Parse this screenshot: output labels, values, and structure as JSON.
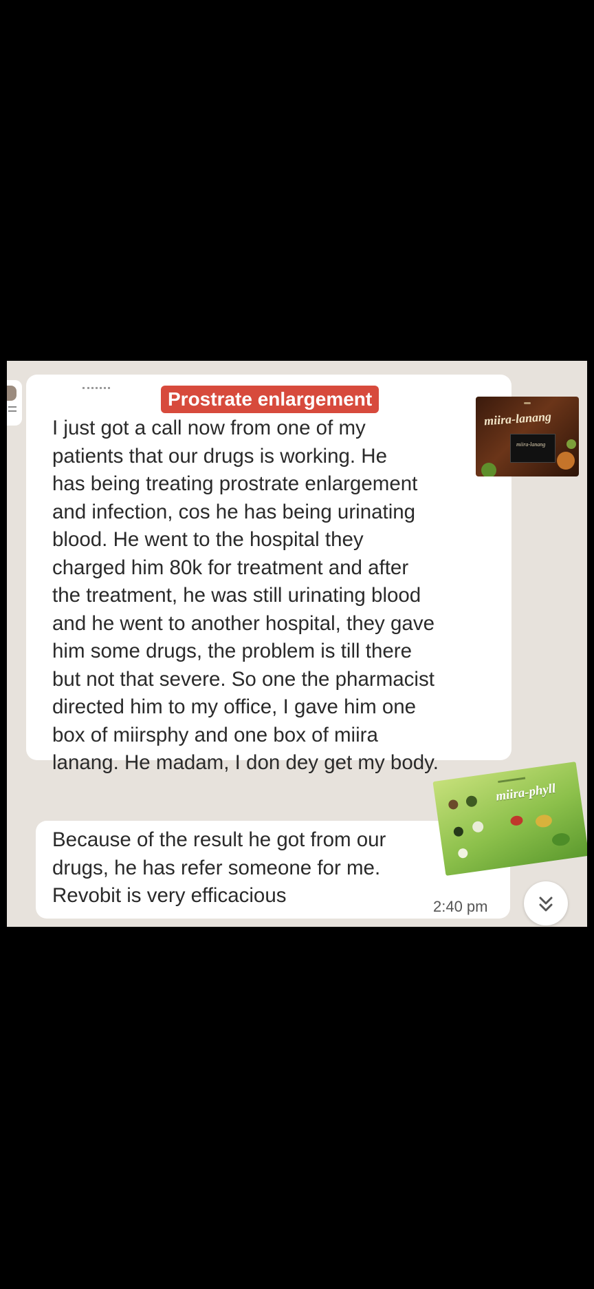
{
  "chat": {
    "badge": "Prostrate enlargement",
    "message_1_lines": [
      "I just got a call now from one of my",
      "patients that our drugs is working. He",
      "has being treating prostrate enlargement",
      "and infection, cos he has being urinating",
      "blood. He went to the hospital they",
      "charged him 80k for treatment and after",
      "the treatment, he was still urinating blood",
      "and he went to another hospital, they gave",
      "him some drugs, the problem is till there",
      "but not that severe. So one the pharmacist",
      "directed him to my office, I gave him one",
      "box of miirsphy and one box of miira",
      "lanang. He madam, I don dey get my body."
    ],
    "message_2_lines": [
      "Because of the result he got from our",
      "drugs, he has refer someone for me.",
      "Revobit is very efficacious"
    ],
    "timestamp": "2:40 pm"
  },
  "products": {
    "product_1_label": "miira-lanang",
    "product_1_box_label": "miira-lanang",
    "product_2_label": "miira-phyll"
  },
  "icons": {
    "scroll": "double-chevron-down-icon"
  },
  "colors": {
    "background": "#000000",
    "chat_background": "#e7e2dc",
    "bubble": "#ffffff",
    "badge": "#d74a3c",
    "text": "#2a2a2a"
  }
}
